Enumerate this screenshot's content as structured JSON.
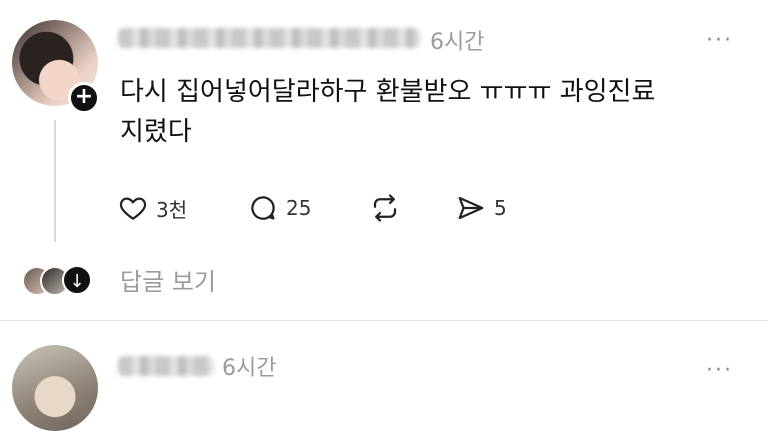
{
  "post1": {
    "time": "6시간",
    "more": "···",
    "text_line1": "다시 집어넣어달라하구 환불받오 ㅠㅠㅠ 과잉진료",
    "text_line2": "지렸다",
    "actions": {
      "likes": "3천",
      "comments": "25",
      "shares": "5"
    },
    "view_replies": "답글 보기"
  },
  "post2": {
    "time": "6시간",
    "more": "···"
  }
}
